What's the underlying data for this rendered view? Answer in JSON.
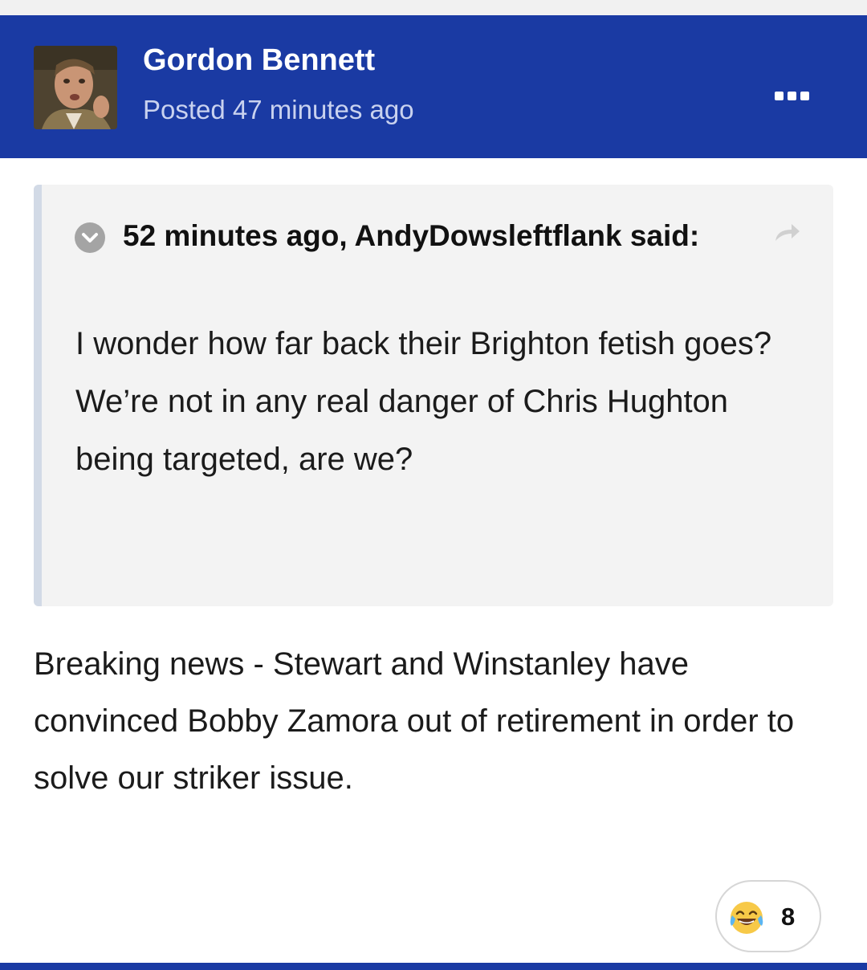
{
  "colors": {
    "header_bg": "#1a3aa3",
    "header_text": "#ffffff",
    "header_subtext": "#c9d2ef",
    "quote_bg": "#f3f3f3",
    "quote_bar": "#d2dae6"
  },
  "post": {
    "author": "Gordon Bennett",
    "time": "Posted 47 minutes ago",
    "menu_icon": "ellipsis-icon",
    "body": "Breaking news - Stewart and Winstanley have convinced Bobby Zamora out of retirement in order to solve our striker issue."
  },
  "quote": {
    "citation": "52 minutes ago, AndyDowsleftflank said:",
    "toggle_icon": "chevron-down-icon",
    "share_icon": "share-arrow-icon",
    "text": "I wonder how far back their Brighton fetish goes? We’re not in any real danger of Chris Hughton being targeted, are we?"
  },
  "reaction": {
    "icon": "laughing-tears-icon",
    "count": "8"
  }
}
